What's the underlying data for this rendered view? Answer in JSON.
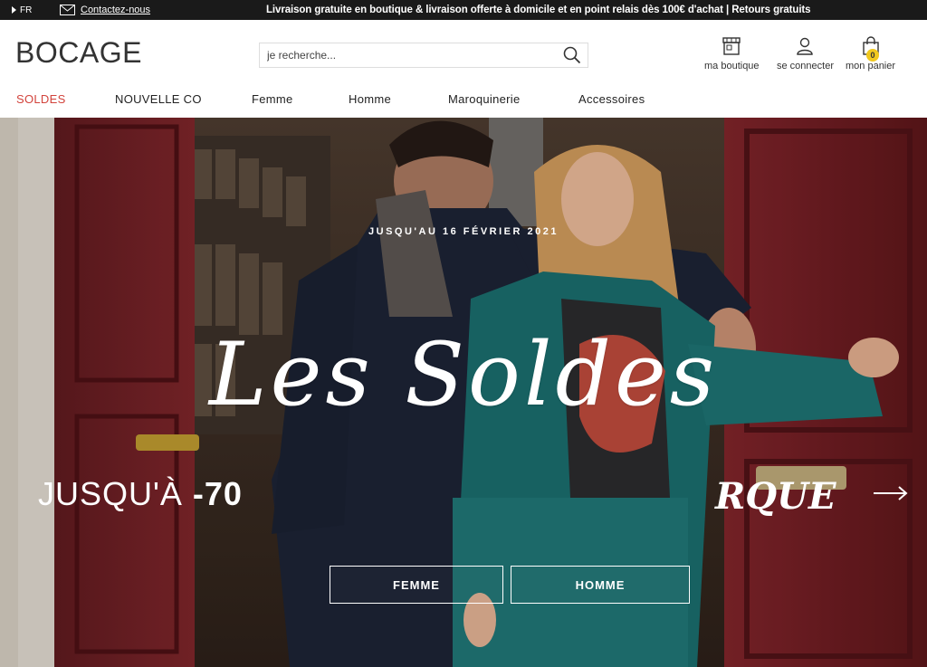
{
  "topbar": {
    "language": "FR",
    "contact_label": "Contactez-nous",
    "promo_text": "Livraison gratuite en boutique & livraison offerte à domicile et en point relais dès 100€ d'achat | Retours gratuits"
  },
  "header": {
    "logo": "BOCAGE",
    "search_placeholder": "je recherche...",
    "icons": [
      {
        "label": "ma boutique",
        "icon": "store-icon"
      },
      {
        "label": "se connecter",
        "icon": "user-icon"
      },
      {
        "label": "mon panier",
        "icon": "bag-icon",
        "count": "0"
      }
    ],
    "badge_color": "#f0c81e"
  },
  "nav": {
    "items": [
      "SOLDES",
      "NOUVELLE CO",
      "Femme",
      "Homme",
      "Maroquinerie",
      "Accessoires"
    ],
    "highlight_color": "#d2433c"
  },
  "hero": {
    "date_text": "JUSQU'AU 16 FÉVRIER 2021",
    "title": "Les Soldes",
    "slide_left_prefix": "JUSQU'À ",
    "slide_left_value": "-70",
    "slide_right_text": "RQUE",
    "buttons": [
      "FEMME",
      "HOMME"
    ]
  }
}
